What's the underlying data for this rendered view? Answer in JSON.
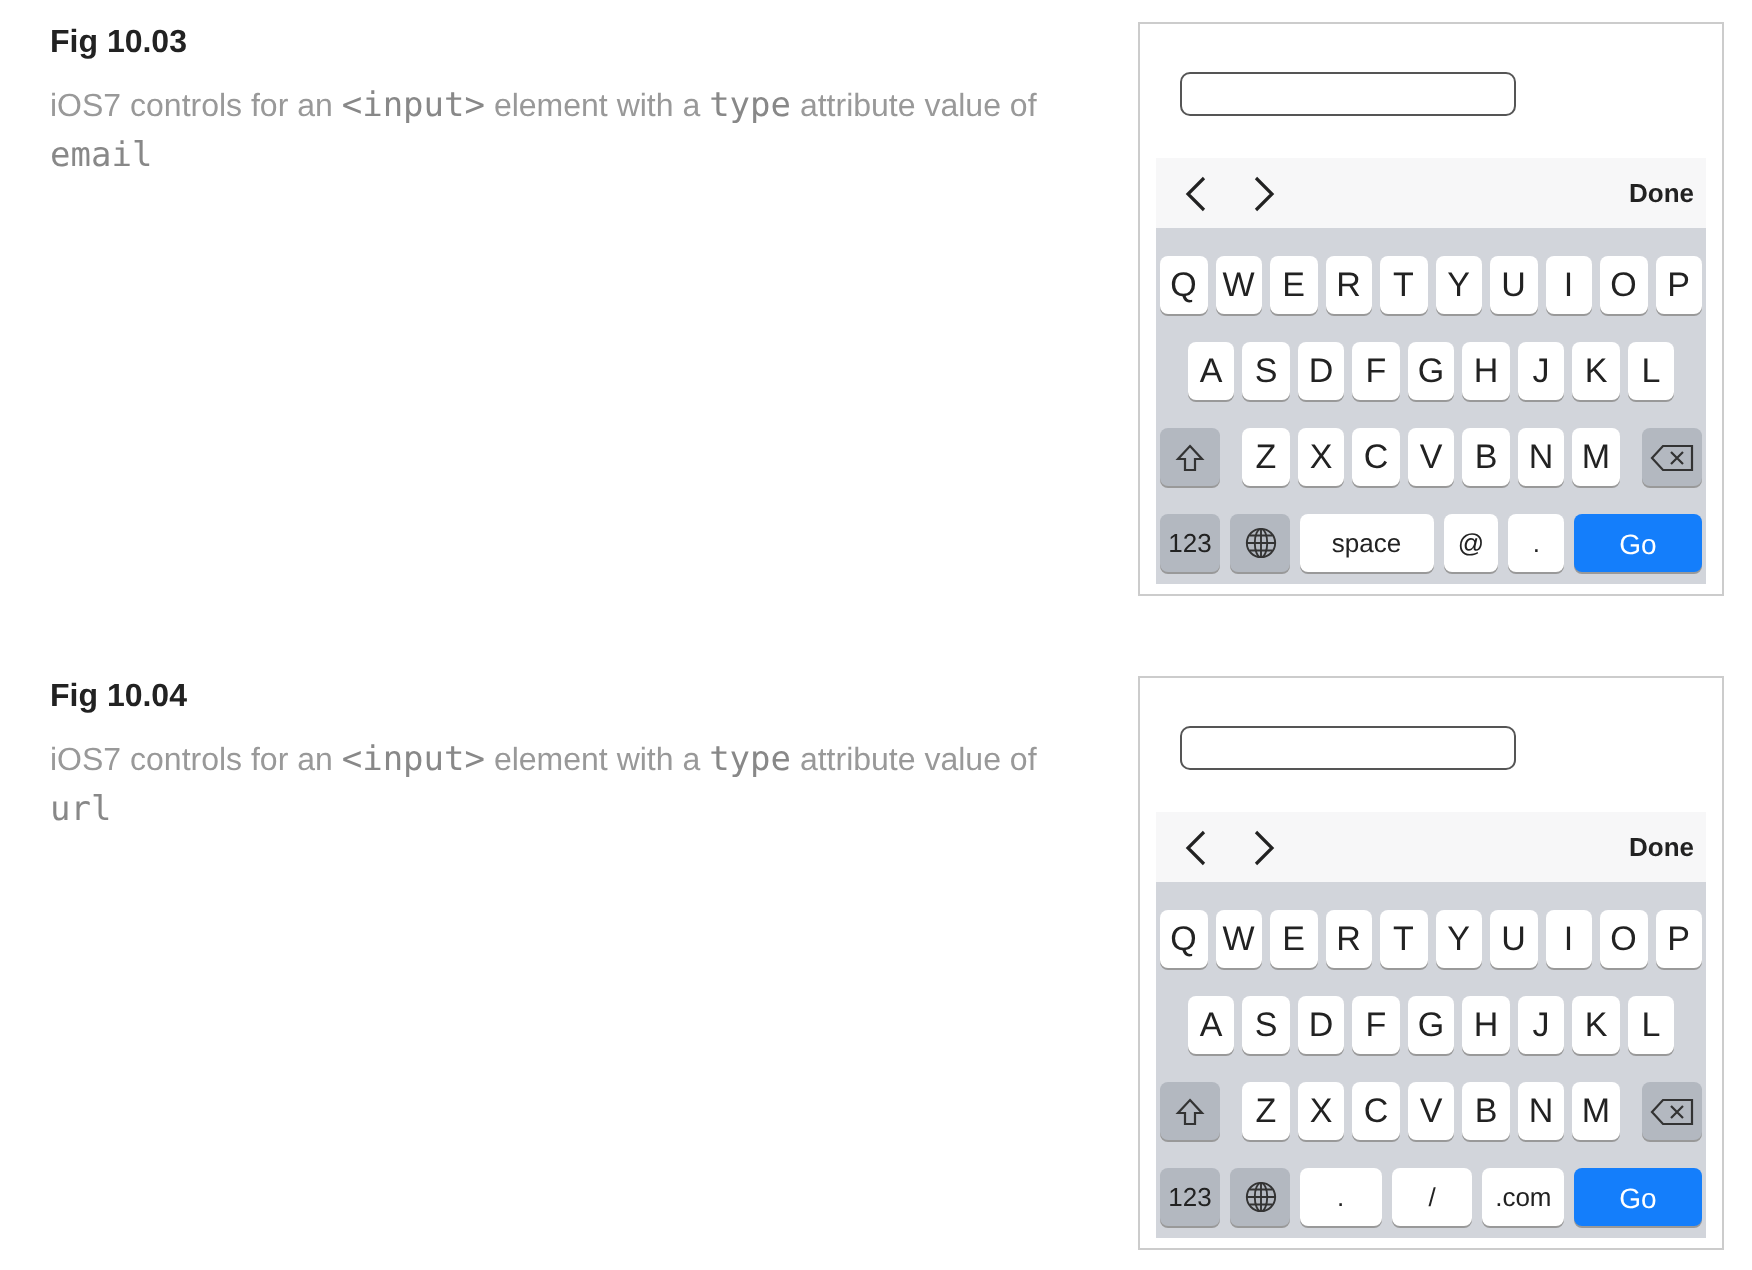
{
  "figures": [
    {
      "title": "Fig 10.03",
      "caption": [
        {
          "kind": "text",
          "text": "iOS7 controls for an "
        },
        {
          "kind": "code",
          "text": "<input>"
        },
        {
          "kind": "text",
          "text": " element with a "
        },
        {
          "kind": "code",
          "text": "type"
        },
        {
          "kind": "text",
          "text": " attribute value of "
        },
        {
          "kind": "code",
          "text": "email"
        }
      ],
      "toolbar": {
        "done": "Done"
      },
      "keyboard": {
        "top_row": [
          "Q",
          "W",
          "E",
          "R",
          "T",
          "Y",
          "U",
          "I",
          "O",
          "P"
        ],
        "middle_row": [
          "A",
          "S",
          "D",
          "F",
          "G",
          "H",
          "J",
          "K",
          "L"
        ],
        "shift_row": [
          "Z",
          "X",
          "C",
          "V",
          "B",
          "N",
          "M"
        ],
        "bottom_row": [
          {
            "kind": "numbers",
            "label": "123"
          },
          {
            "kind": "globe"
          },
          {
            "kind": "space",
            "label": "space"
          },
          {
            "kind": "char",
            "label": "@"
          },
          {
            "kind": "char",
            "label": "."
          },
          {
            "kind": "go",
            "label": "Go"
          }
        ]
      }
    },
    {
      "title": "Fig 10.04",
      "caption": [
        {
          "kind": "text",
          "text": "iOS7 controls for an "
        },
        {
          "kind": "code",
          "text": "<input>"
        },
        {
          "kind": "text",
          "text": " element with a "
        },
        {
          "kind": "code",
          "text": "type"
        },
        {
          "kind": "text",
          "text": " attribute value of "
        },
        {
          "kind": "code",
          "text": "url"
        }
      ],
      "toolbar": {
        "done": "Done"
      },
      "keyboard": {
        "top_row": [
          "Q",
          "W",
          "E",
          "R",
          "T",
          "Y",
          "U",
          "I",
          "O",
          "P"
        ],
        "middle_row": [
          "A",
          "S",
          "D",
          "F",
          "G",
          "H",
          "J",
          "K",
          "L"
        ],
        "shift_row": [
          "Z",
          "X",
          "C",
          "V",
          "B",
          "N",
          "M"
        ],
        "bottom_row": [
          {
            "kind": "numbers",
            "label": "123"
          },
          {
            "kind": "globe"
          },
          {
            "kind": "char",
            "label": "."
          },
          {
            "kind": "char",
            "label": "/"
          },
          {
            "kind": "char",
            "label": ".com"
          },
          {
            "kind": "go",
            "label": "Go"
          }
        ]
      }
    }
  ]
}
